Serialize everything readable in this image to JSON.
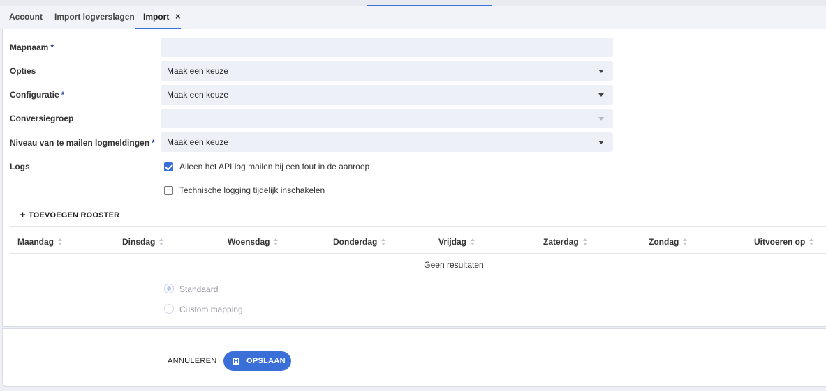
{
  "tabs": [
    {
      "label": "Account"
    },
    {
      "label": "Import logverslagen"
    },
    {
      "label": "Import"
    }
  ],
  "tab_close_glyph": "×",
  "form": {
    "folder_name": {
      "label": "Mapnaam",
      "required": "*",
      "value": ""
    },
    "options": {
      "label": "Opties",
      "value": "Maak een keuze"
    },
    "configuration": {
      "label": "Configuratie",
      "required": "*",
      "value": "Maak een keuze"
    },
    "conversion_group": {
      "label": "Conversiegroep",
      "value": ""
    },
    "mail_level": {
      "label": "Niveau van te mailen logmeldingen",
      "required": "*",
      "value": "Maak een keuze"
    },
    "logs": {
      "label": "Logs",
      "options": [
        {
          "label": "Alleen het API log mailen bij een fout in de aanroep",
          "checked": true
        },
        {
          "label": "Technische logging tijdelijk inschakelen",
          "checked": false
        }
      ]
    }
  },
  "schedule": {
    "add_label": "TOEVOEGEN ROOSTER",
    "columns": [
      "Maandag",
      "Dinsdag",
      "Woensdag",
      "Donderdag",
      "Vrijdag",
      "Zaterdag",
      "Zondag",
      "Uitvoeren op"
    ],
    "empty_text": "Geen resultaten"
  },
  "mapping": {
    "options": [
      {
        "label": "Standaard",
        "selected": true
      },
      {
        "label": "Custom mapping",
        "selected": false
      }
    ]
  },
  "actions": {
    "cancel_label": "ANNULEREN",
    "save_label": "OPSLAAN"
  },
  "colors": {
    "accent": "#3a6fd8",
    "field_bg": "#eef0f8",
    "required_star": "#1a3a8a"
  }
}
